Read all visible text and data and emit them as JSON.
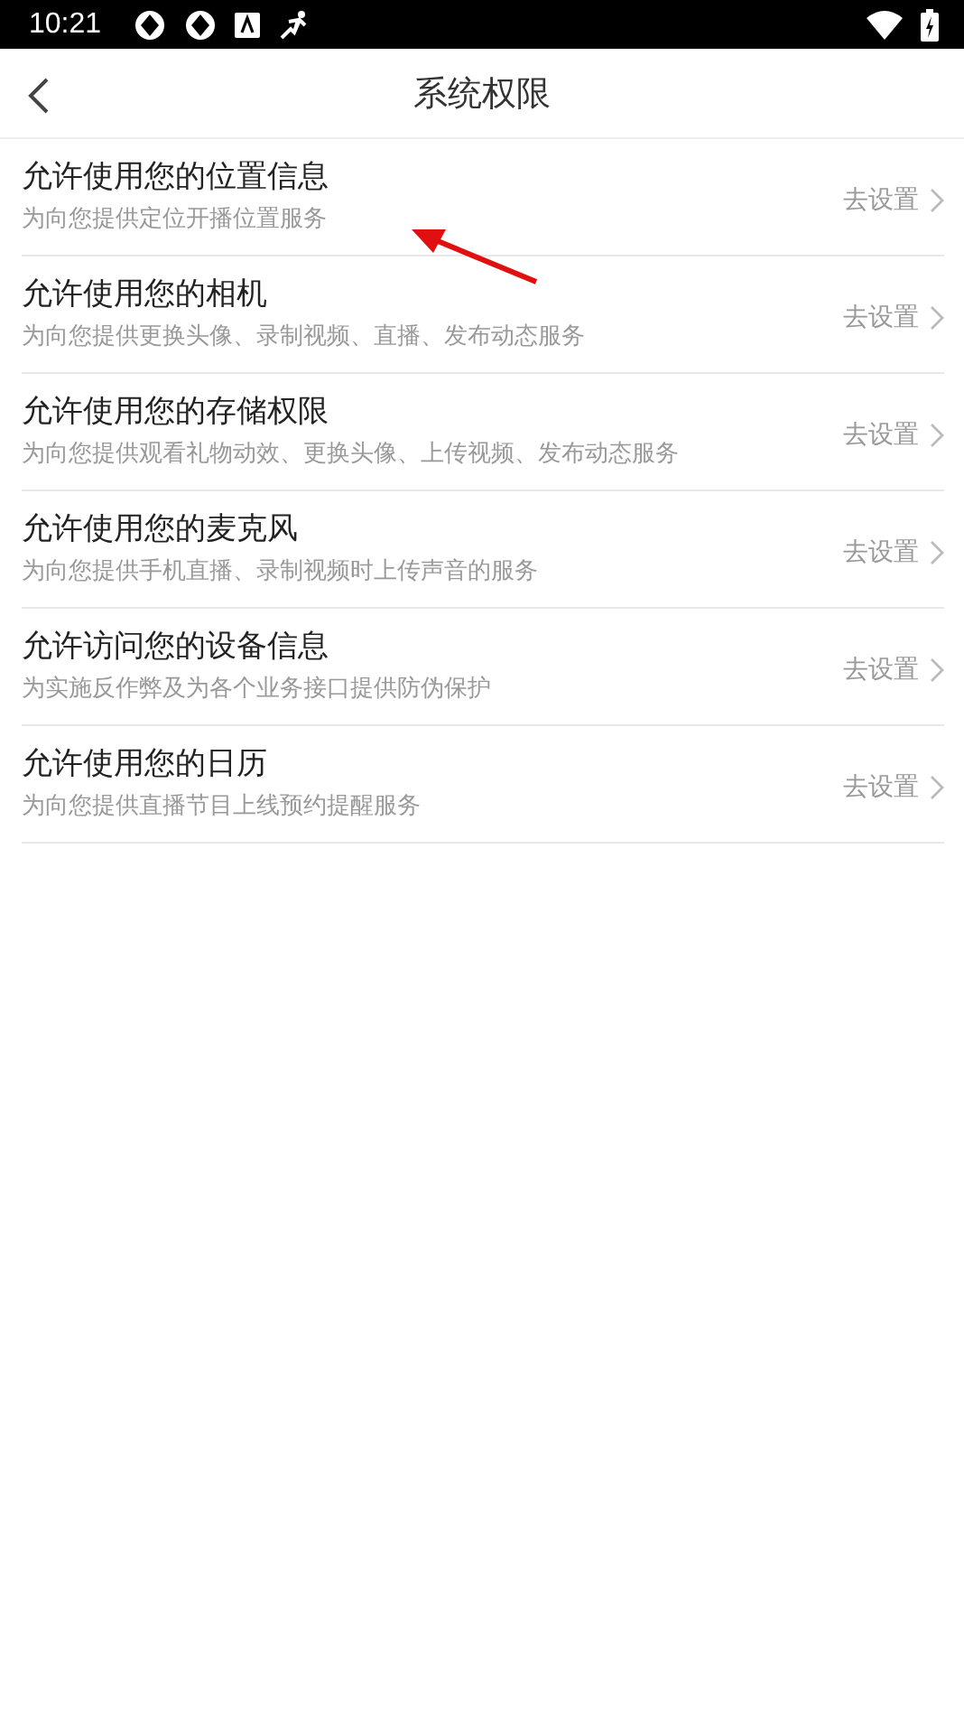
{
  "status_bar": {
    "time": "10:21"
  },
  "header": {
    "title": "系统权限"
  },
  "permissions": [
    {
      "title": "允许使用您的位置信息",
      "description": "为向您提供定位开播位置服务",
      "action": "去设置"
    },
    {
      "title": "允许使用您的相机",
      "description": "为向您提供更换头像、录制视频、直播、发布动态服务",
      "action": "去设置"
    },
    {
      "title": "允许使用您的存储权限",
      "description": "为向您提供观看礼物动效、更换头像、上传视频、发布动态服务",
      "action": "去设置"
    },
    {
      "title": "允许使用您的麦克风",
      "description": "为向您提供手机直播、录制视频时上传声音的服务",
      "action": "去设置"
    },
    {
      "title": "允许访问您的设备信息",
      "description": "为实施反作弊及为各个业务接口提供防伪保护",
      "action": "去设置"
    },
    {
      "title": "允许使用您的日历",
      "description": "为向您提供直播节目上线预约提醒服务",
      "action": "去设置"
    }
  ]
}
